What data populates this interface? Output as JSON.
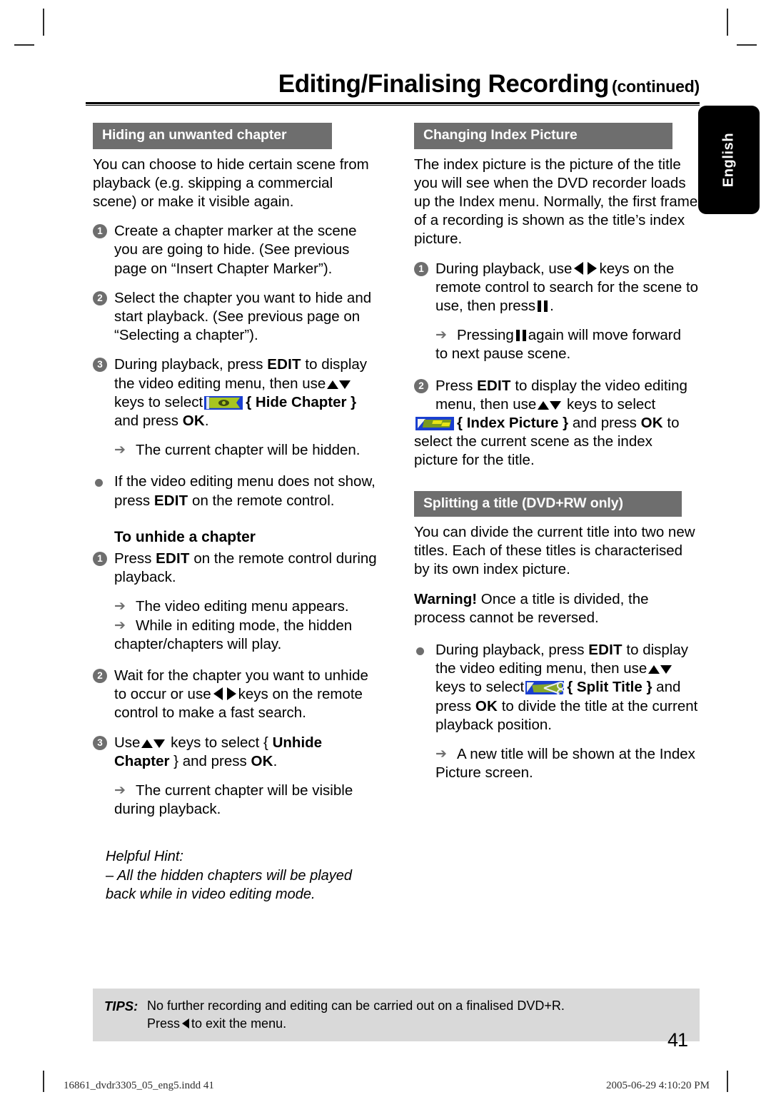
{
  "header": {
    "title_main": "Editing/Finalising Recording",
    "title_continued": "(continued)"
  },
  "language_tab": {
    "label": "English"
  },
  "left_column": {
    "section_title": "Hiding an unwanted chapter",
    "intro": "You can choose to hide certain scene from playback (e.g. skipping a commercial scene) or make it visible again.",
    "step1_num": "1",
    "step1": "Create a chapter marker at the scene you are going to hide. (See previous page on “Insert Chapter Marker”).",
    "step2_num": "2",
    "step2": "Select the chapter you want to hide and start playback. (See previous page on “Selecting a chapter”).",
    "step3_num": "3",
    "step3_a": "During playback, press",
    "step3_edit": "EDIT",
    "step3_b": "to display the video editing menu, then use",
    "step3_c": "keys to select",
    "step3_brace_open": "{",
    "step3_menu_item": "Hide Chapter",
    "step3_brace_close": "}",
    "step3_d": "and press",
    "step3_ok": "OK",
    "step3_period": ".",
    "step3_result": "The current chapter will be hidden.",
    "bullet_a": "If the video editing menu does not show, press",
    "bullet_a_edit": "EDIT",
    "bullet_a_end": "on the remote control.",
    "subhead": "To unhide a chapter",
    "u1_num": "1",
    "u1_a": "Press",
    "u1_edit": "EDIT",
    "u1_b": "on the remote control during playback.",
    "u1_result1": "The video editing menu appears.",
    "u1_result2": "While in editing mode, the hidden",
    "u1_result2_cont": "chapter/chapters will play.",
    "u2_num": "2",
    "u2_a": "Wait for the chapter you want to unhide to occur or use",
    "u2_b": "keys on the remote control to make a fast search.",
    "u3_num": "3",
    "u3_a": "Use",
    "u3_b": "keys to select {",
    "u3_menu_item": "Unhide Chapter",
    "u3_c": "} and press",
    "u3_ok": "OK",
    "u3_period": ".",
    "u3_result": "The current chapter will be visible",
    "u3_result_cont": "during playback.",
    "hint_label": "Helpful Hint:",
    "hint_text": "– All the hidden chapters will be played back while in video editing mode."
  },
  "right_column": {
    "section_title": "Changing Index Picture",
    "intro": "The index picture is the picture of the title you will see when the DVD recorder loads up the Index menu. Normally, the first frame of a recording is shown as the title’s index picture.",
    "step1_num": "1",
    "step1_a": "During playback, use",
    "step1_b": "keys on the remote control to search for the scene to use, then press",
    "step1_c": ".",
    "step1_result_a": "Pressing",
    "step1_result_b": "again will move forward",
    "step1_result_cont": "to next pause scene.",
    "step2_num": "2",
    "step2_a": "Press",
    "step2_edit": "EDIT",
    "step2_b": "to display the video editing menu, then use",
    "step2_c": "keys to select",
    "step2_brace_open": "{",
    "step2_menu_item": "Index Picture",
    "step2_brace_close": "}",
    "step2_d": "and press",
    "step2_ok": "OK",
    "step2_e": "to select the current scene as the index picture for the title.",
    "section2_title": "Splitting a title (DVD+RW only)",
    "s2_intro": "You can divide the current title into two new titles. Each of these titles is characterised by its own index picture.",
    "warning_label": "Warning!",
    "warning_text": "Once a title is divided, the process cannot be reversed.",
    "s2_bullet_a": "During playback, press",
    "s2_bullet_edit": "EDIT",
    "s2_bullet_b": "to display the video editing menu, then use",
    "s2_bullet_c": "keys to select",
    "s2_brace_open": "{",
    "s2_menu_item": "Split Title",
    "s2_brace_close": "}",
    "s2_bullet_d": "and press",
    "s2_ok": "OK",
    "s2_bullet_e": "to divide the title at the current playback position.",
    "s2_result": "A new title will be shown at the Index",
    "s2_result_cont": "Picture screen."
  },
  "tips": {
    "label": "TIPS:",
    "line1": "No further recording and editing can be carried out on a finalised DVD+R.",
    "line2_a": "Press",
    "line2_b": "to exit the menu."
  },
  "page_number": "41",
  "imprint": {
    "file": "16861_dvdr3305_05_eng5.indd   41",
    "date": "2005-06-29   4:10:20 PM"
  },
  "icons": {
    "hide_chapter": "hide-chapter-menu-icon",
    "index_picture": "index-picture-menu-icon",
    "split_title": "split-title-menu-icon"
  },
  "colors": {
    "section_bar": "#6e6e6e",
    "tips_bg": "#d9d9d9",
    "icon_blue": "#1a3fd0",
    "icon_green": "#86a72a"
  }
}
